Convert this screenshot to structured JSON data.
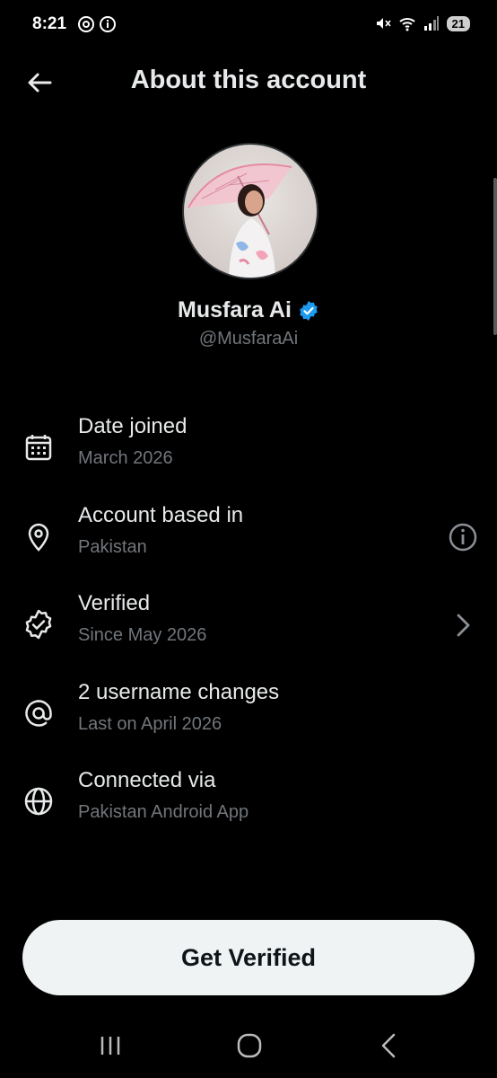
{
  "status_bar": {
    "time": "8:21",
    "battery": "21"
  },
  "header": {
    "title": "About this account"
  },
  "profile": {
    "name": "Musfara Ai",
    "handle": "@MusfaraAi"
  },
  "rows": [
    {
      "icon": "calendar-icon",
      "label": "Date joined",
      "sub": "March 2026"
    },
    {
      "icon": "location-pin-icon",
      "label": "Account based in",
      "sub": "Pakistan",
      "right_icon": "info-icon"
    },
    {
      "icon": "verified-badge-icon",
      "label": "Verified",
      "sub": "Since May 2026",
      "right_icon": "chevron-right-icon"
    },
    {
      "icon": "at-sign-icon",
      "label": "2 username changes",
      "sub": "Last on April 2026"
    },
    {
      "icon": "globe-icon",
      "label": "Connected via",
      "sub": "Pakistan Android App"
    }
  ],
  "cta": {
    "label": "Get Verified"
  },
  "colors": {
    "background": "#000000",
    "text": "#e7e9ea",
    "secondary": "#71767b",
    "verified": "#1d9bf0",
    "button_bg": "#eff3f4"
  }
}
